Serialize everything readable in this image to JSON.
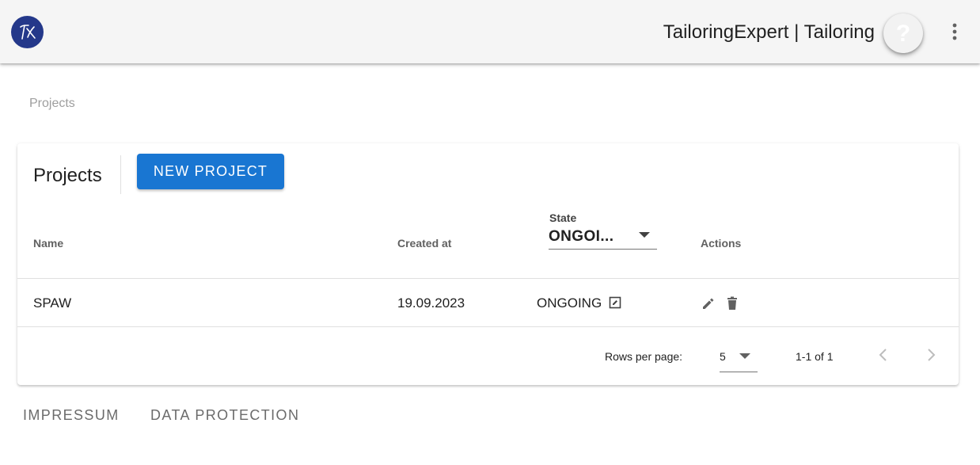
{
  "header": {
    "title": "TailoringExpert | Tailoring",
    "logo_text": "TX",
    "help_label": "?",
    "menu_icon": "more-vert-icon"
  },
  "breadcrumb": "Projects",
  "card": {
    "title": "Projects",
    "new_project_label": "NEW PROJECT"
  },
  "table": {
    "columns": {
      "name": "Name",
      "created_at": "Created at",
      "state": "State",
      "actions": "Actions"
    },
    "state_filter_value": "ONGOI...",
    "rows": [
      {
        "name": "SPAW",
        "created_at": "19.09.2023",
        "state": "ONGOING"
      }
    ],
    "footer": {
      "rows_per_page_label": "Rows per page:",
      "rows_per_page_value": "5",
      "range": "1-1 of 1"
    }
  },
  "footer_links": {
    "impressum": "IMPRESSUM",
    "data_protection": "DATA PROTECTION"
  },
  "colors": {
    "primary": "#1976d2",
    "logo": "#24388a",
    "appbar": "#f5f5f5"
  }
}
